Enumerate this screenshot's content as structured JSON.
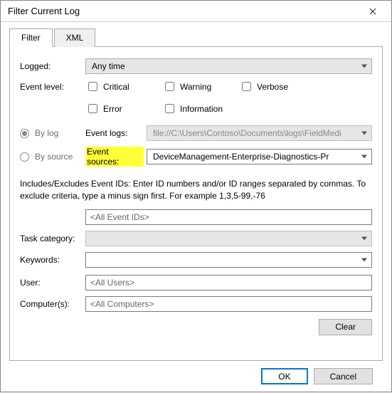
{
  "title": "Filter Current Log",
  "tabs": {
    "filter": "Filter",
    "xml": "XML"
  },
  "labels": {
    "logged": "Logged:",
    "eventLevel": "Event level:",
    "byLog": "By log",
    "bySource": "By source",
    "eventLogs": "Event logs:",
    "eventSources": "Event sources:",
    "taskCategory": "Task category:",
    "keywords": "Keywords:",
    "user": "User:",
    "computers": "Computer(s):"
  },
  "loggedValue": "Any time",
  "eventLevelOptions": {
    "critical": "Critical",
    "warning": "Warning",
    "verbose": "Verbose",
    "error": "Error",
    "information": "Information"
  },
  "eventLogsValue": "file://C:\\Users\\Contoso\\Documents\\logs\\FieldMedi",
  "eventSourcesValue": "DeviceManagement-Enterprise-Diagnostics-Pr",
  "helpText": "Includes/Excludes Event IDs: Enter ID numbers and/or ID ranges separated by commas. To exclude criteria, type a minus sign first. For example 1,3,5-99,-76",
  "placeholders": {
    "eventIds": "<All Event IDs>",
    "users": "<All Users>",
    "computers": "<All Computers>"
  },
  "buttons": {
    "clear": "Clear",
    "ok": "OK",
    "cancel": "Cancel"
  }
}
